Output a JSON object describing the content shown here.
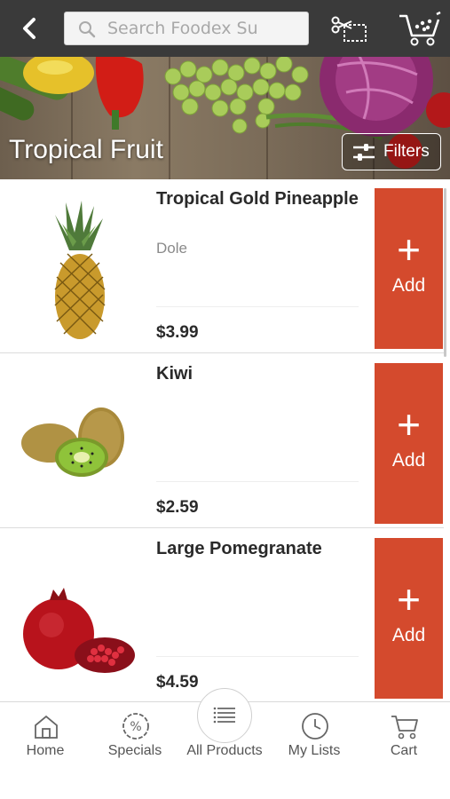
{
  "header": {
    "search_placeholder": "Search Foodex Su",
    "icons": [
      "back-arrow-icon",
      "search-icon",
      "coupon-scissors-icon",
      "shopping-cart-icon"
    ]
  },
  "banner": {
    "title": "Tropical Fruit",
    "filters_label": "Filters"
  },
  "products": [
    {
      "name": "Tropical Gold Pineapple",
      "brand": "Dole",
      "price": "$3.99",
      "add_label": "Add",
      "plus": "+"
    },
    {
      "name": "Kiwi",
      "brand": "",
      "price": "$2.59",
      "add_label": "Add",
      "plus": "+"
    },
    {
      "name": "Large Pomegranate",
      "brand": "",
      "price": "$4.59",
      "add_label": "Add",
      "plus": "+"
    }
  ],
  "tabs": [
    {
      "label": "Home",
      "icon": "home-icon"
    },
    {
      "label": "Specials",
      "icon": "percent-badge-icon"
    },
    {
      "label": "All Products",
      "icon": "list-icon"
    },
    {
      "label": "My Lists",
      "icon": "clock-icon"
    },
    {
      "label": "Cart",
      "icon": "cart-icon"
    }
  ],
  "colors": {
    "topbar": "#3a3a3a",
    "accent": "#d44a2d"
  }
}
